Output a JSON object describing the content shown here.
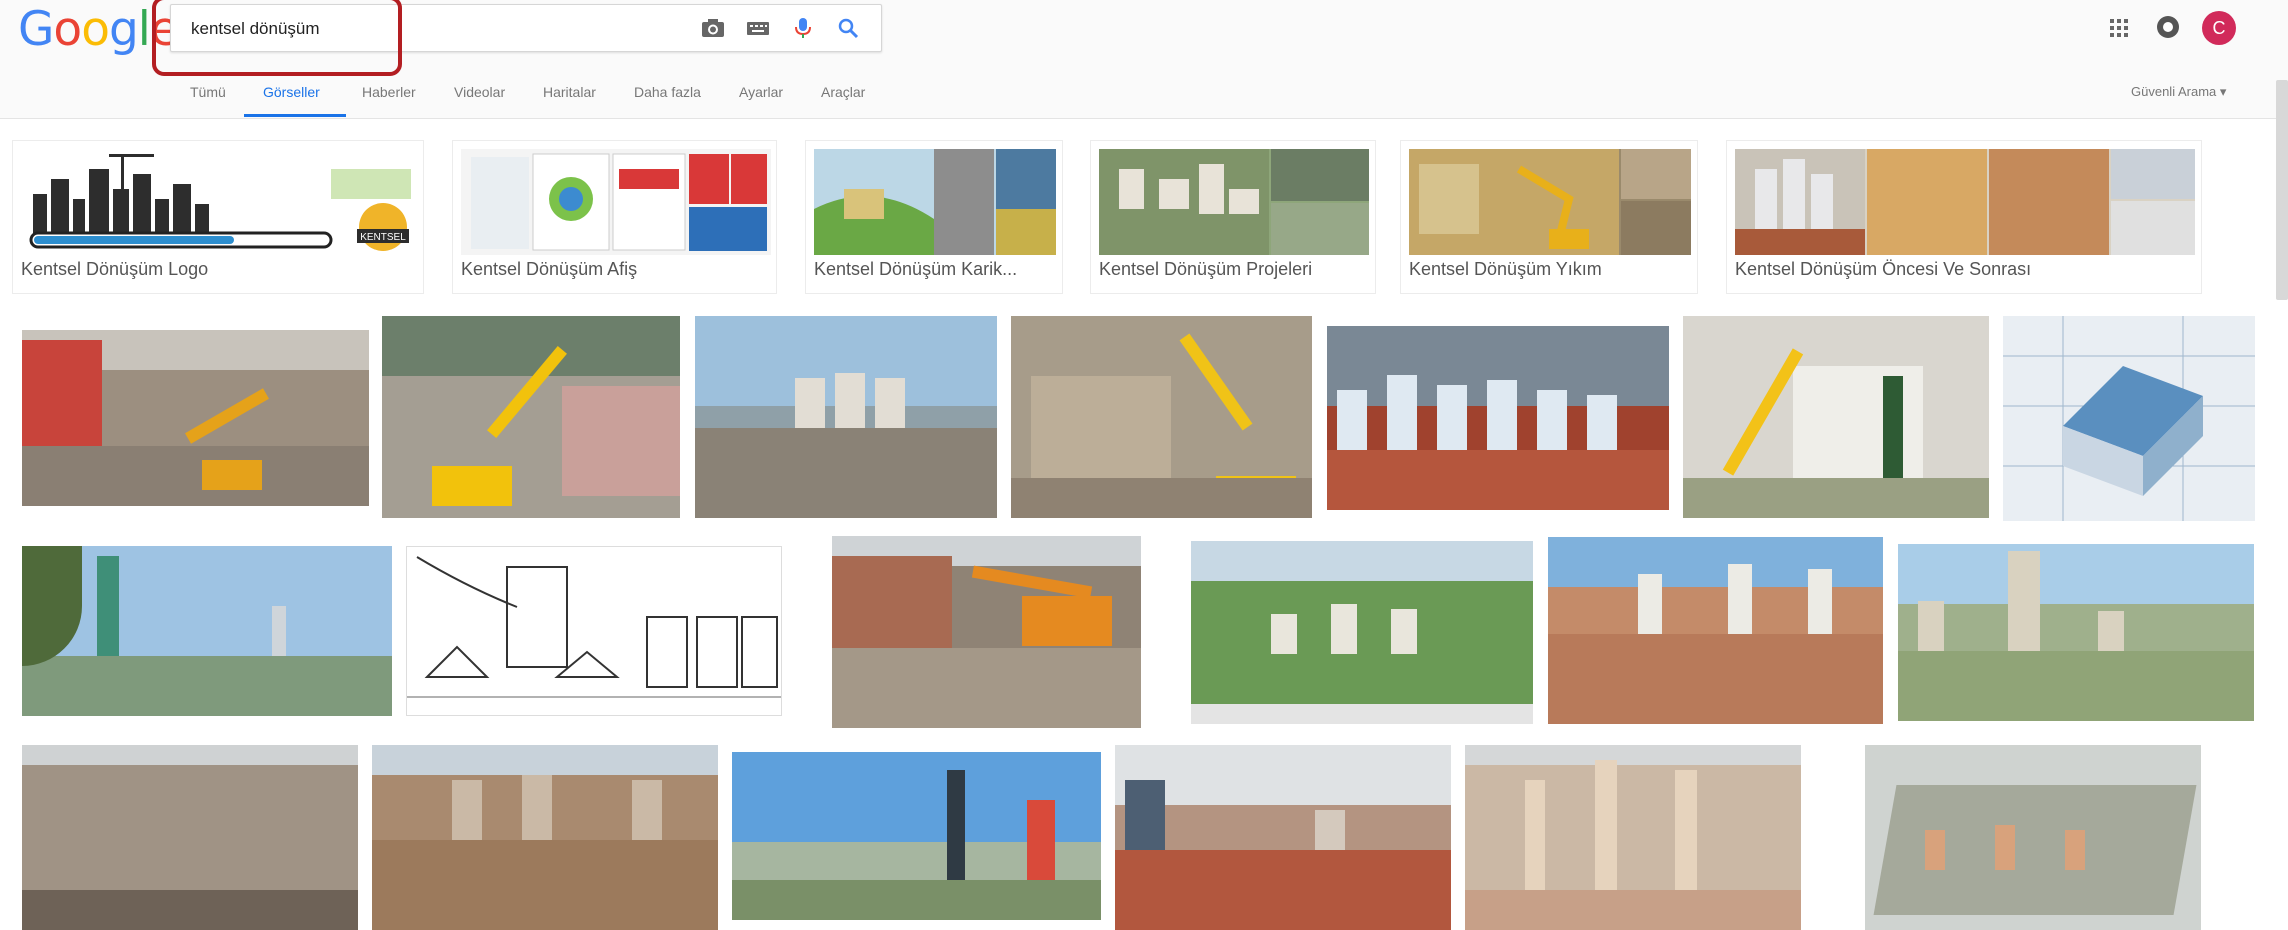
{
  "search": {
    "query": "kentsel dönüşüm"
  },
  "logo": {
    "letters": [
      "G",
      "o",
      "o",
      "g",
      "l",
      "e"
    ]
  },
  "tabs": [
    "Tümü",
    "Görseller",
    "Haberler",
    "Videolar",
    "Haritalar",
    "Daha fazla",
    "Ayarlar",
    "Araçlar"
  ],
  "active_tab": "Görseller",
  "safe_search_label": "Güvenli Arama ▾",
  "avatar_initial": "C",
  "related": [
    {
      "label": "Kentsel Dönüşüm Logo"
    },
    {
      "label": "Kentsel Dönüşüm Afiş"
    },
    {
      "label": "Kentsel Dönüşüm Karik..."
    },
    {
      "label": "Kentsel Dönüşüm Projeleri"
    },
    {
      "label": "Kentsel Dönüşüm Yıkım"
    },
    {
      "label": "Kentsel Dönüşüm Öncesi Ve Sonrası"
    }
  ],
  "logo_badge_text": "KENTSEL",
  "colors": {
    "google_blue": "#4285F4",
    "google_red": "#EA4335",
    "google_yellow": "#FBBC05",
    "google_green": "#34A853",
    "highlight": "#b31e22",
    "active_tab": "#1a73e8",
    "avatar": "#d12a5a"
  },
  "icons": [
    "camera-icon",
    "keyboard-icon",
    "microphone-icon",
    "search-icon",
    "apps-grid-icon",
    "notifications-icon"
  ]
}
